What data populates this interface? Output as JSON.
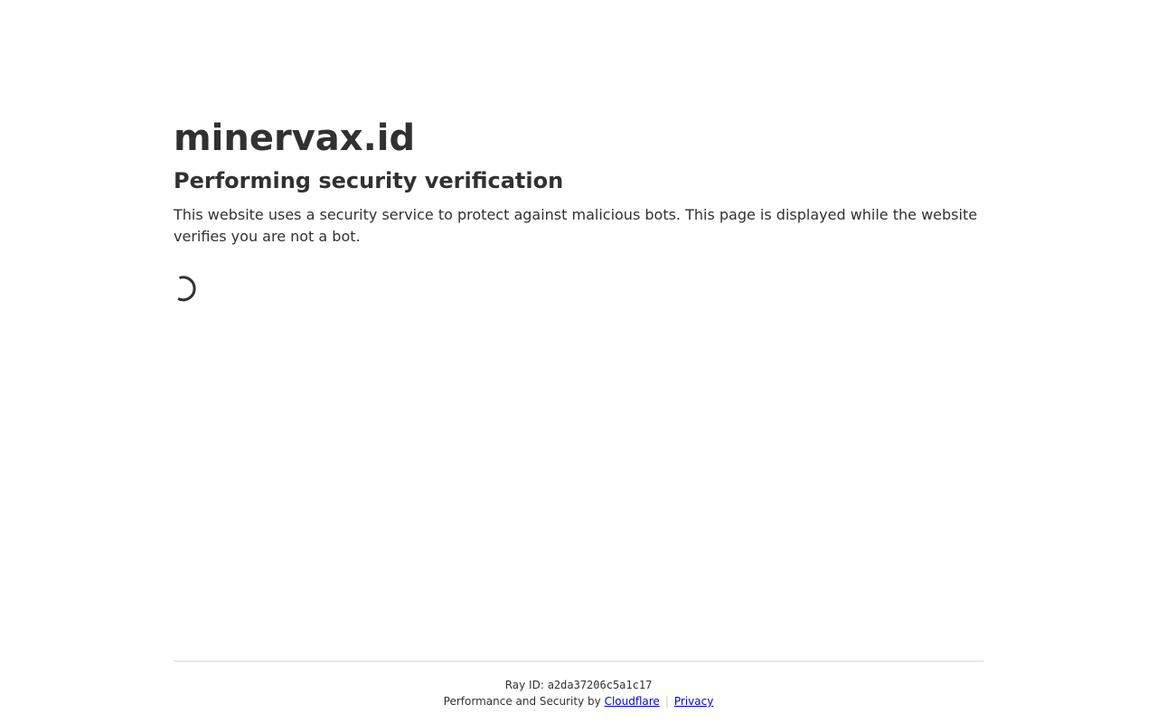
{
  "site": {
    "title": "minervax.id"
  },
  "verification": {
    "heading": "Performing security verification",
    "description": "This website uses a security service to protect against malicious bots. This page is displayed while the website verifies you are not a bot."
  },
  "footer": {
    "ray_label": "Ray ID:",
    "ray_id": "a2da37206c5a1c17",
    "performance_text": "Performance and Security by",
    "cloudflare_link": "Cloudflare",
    "separator": "|",
    "privacy_link": "Privacy"
  },
  "colors": {
    "text": "#313131",
    "link": "#0000ee",
    "divider": "#d9d9d9"
  },
  "icons": {
    "spinner": "loading-spinner-icon"
  }
}
